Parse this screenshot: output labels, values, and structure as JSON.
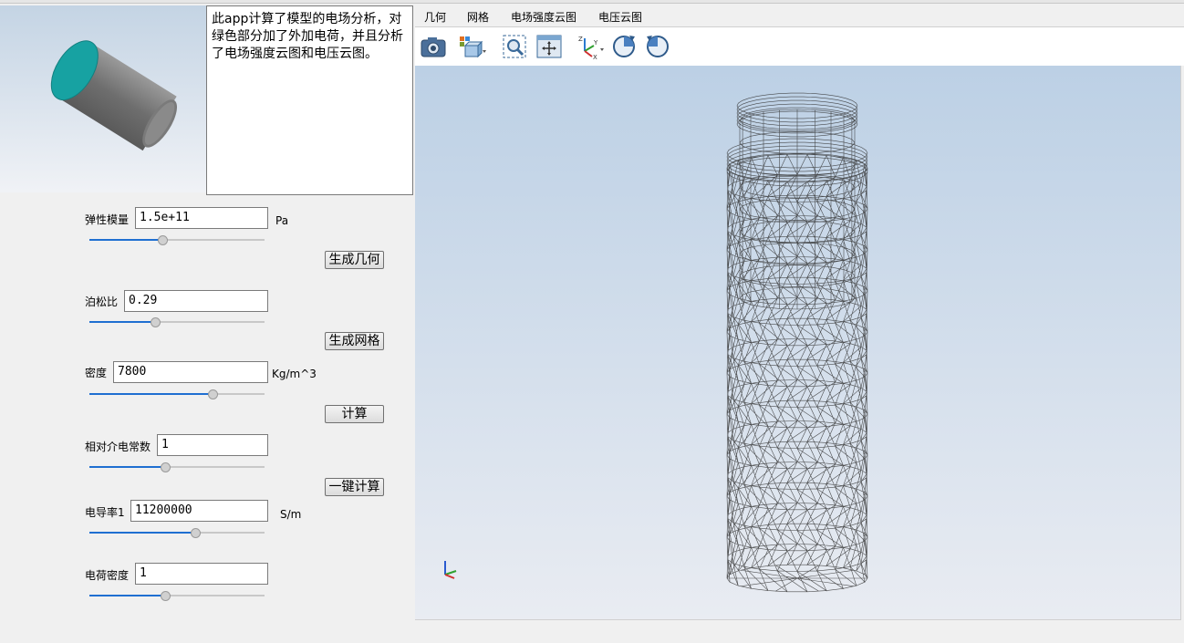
{
  "description": "此app计算了模型的电场分析，对绿色部分加了外加电荷，并且分析了电场强度云图和电压云图。",
  "tabs": [
    "几何",
    "网格",
    "电场强度云图",
    "电压云图"
  ],
  "params": {
    "youngs_modulus": {
      "label": "弹性模量",
      "value": "1.5e+11",
      "unit": "Pa",
      "slider_fraction": 0.42
    },
    "poisson_ratio": {
      "label": "泊松比",
      "value": "0.29",
      "slider_fraction": 0.38
    },
    "density": {
      "label": "密度",
      "value": "7800",
      "unit": "Kg/m^3",
      "slider_fraction": 0.71
    },
    "permittivity": {
      "label": "相对介电常数",
      "value": "1",
      "slider_fraction": 0.44
    },
    "conductivity": {
      "label": "电导率1",
      "value": "11200000",
      "unit": "S/m",
      "slider_fraction": 0.61
    },
    "charge_density": {
      "label": "电荷密度",
      "value": "1",
      "slider_fraction": 0.44
    }
  },
  "buttons": {
    "gen_geometry": "生成几何",
    "gen_mesh": "生成网格",
    "compute": "计算",
    "one_click": "一键计算"
  },
  "toolbar_icons": [
    "camera-icon",
    "view-cube-icon",
    "zoom-box-icon",
    "zoom-extents-icon",
    "axes-orient-icon",
    "rotate-cw-icon",
    "rotate-ccw-icon"
  ],
  "colors": {
    "accent": "#1f6fd1",
    "cylinder_cap": "#1aa0a0",
    "mesh": "#333333"
  }
}
